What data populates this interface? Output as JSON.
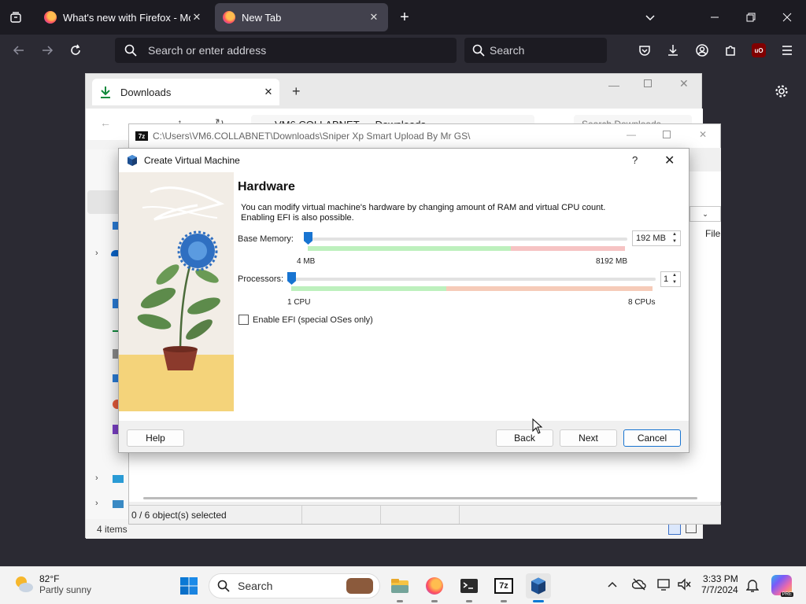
{
  "firefox": {
    "tabs": [
      {
        "title": "What's new with Firefox - More"
      },
      {
        "title": "New Tab"
      }
    ],
    "url_placeholder": "Search or enter address",
    "search_placeholder": "Search",
    "ublock_label": "uO"
  },
  "explorer": {
    "tab_title": "Downloads",
    "breadcrumb": [
      "VM6.COLLABNET",
      "Downloads"
    ],
    "search_placeholder": "Search Downloads",
    "status": "4 items"
  },
  "sevenzip": {
    "title": "C:\\Users\\VM6.COLLABNET\\Downloads\\Sniper Xp Smart Upload By Mr GS\\",
    "column_label": "File",
    "status": "0 / 6 object(s) selected"
  },
  "vbox": {
    "title": "Create Virtual Machine",
    "help_glyph": "?",
    "heading": "Hardware",
    "description": "You can modify virtual machine's hardware by changing amount of RAM and virtual CPU count. Enabling EFI is also possible.",
    "memory": {
      "label": "Base Memory:",
      "value": "192 MB",
      "min_label": "4 MB",
      "max_label": "8192 MB",
      "fraction": 0.023
    },
    "processors": {
      "label": "Processors:",
      "value": "1",
      "min_label": "1 CPU",
      "max_label": "8 CPUs",
      "fraction": 0.0
    },
    "efi": {
      "label": "Enable EFI (special OSes only)",
      "checked": false
    },
    "buttons": {
      "help": "Help",
      "back": "Back",
      "next": "Next",
      "cancel": "Cancel"
    }
  },
  "taskbar": {
    "weather": {
      "temp": "82°F",
      "condition": "Partly sunny"
    },
    "search_placeholder": "Search",
    "time": "3:33 PM",
    "date": "7/7/2024",
    "sevenzip_icon_label": "7z",
    "copilot_badge": "PRE"
  }
}
